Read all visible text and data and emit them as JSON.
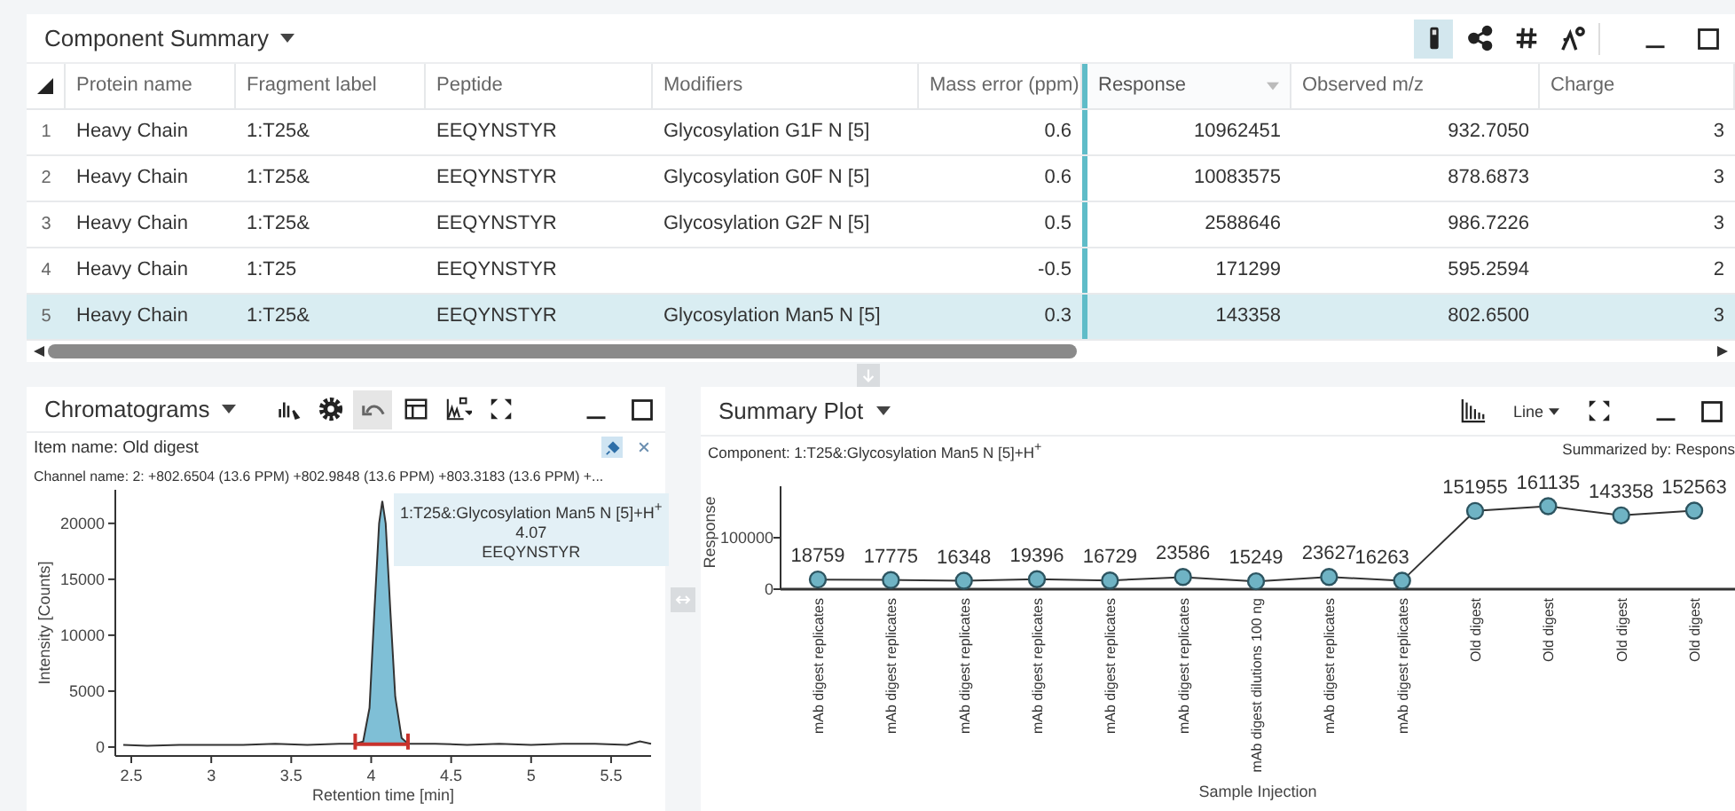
{
  "component_summary": {
    "title": "Component Summary",
    "toolbar": [
      {
        "kind": "test-tube",
        "on": true
      },
      {
        "kind": "nodes",
        "on": false
      },
      {
        "kind": "hash",
        "on": false
      },
      {
        "kind": "peak-settings",
        "on": false
      }
    ],
    "columns": [
      {
        "label": "Protein name",
        "sorted": false
      },
      {
        "label": "Fragment label",
        "sorted": false
      },
      {
        "label": "Peptide",
        "sorted": false
      },
      {
        "label": "Modifiers",
        "sorted": false
      },
      {
        "label": "Mass error (ppm)",
        "sorted": false
      },
      {
        "label": "Response",
        "sorted": true
      },
      {
        "label": "Observed m/z",
        "sorted": false
      },
      {
        "label": "Charge",
        "sorted": false
      }
    ],
    "rows": [
      {
        "number": "1",
        "protein_name": "Heavy Chain",
        "fragment_label": "1:T25&",
        "peptide": "EEQYNSTYR",
        "modifiers": "Glycosylation G1F N [5]",
        "mass_error": "0.6",
        "response": "10962451",
        "observed_mz": "932.7050",
        "charge": "3",
        "selected": false
      },
      {
        "number": "2",
        "protein_name": "Heavy Chain",
        "fragment_label": "1:T25&",
        "peptide": "EEQYNSTYR",
        "modifiers": "Glycosylation G0F N [5]",
        "mass_error": "0.6",
        "response": "10083575",
        "observed_mz": "878.6873",
        "charge": "3",
        "selected": false
      },
      {
        "number": "3",
        "protein_name": "Heavy Chain",
        "fragment_label": "1:T25&",
        "peptide": "EEQYNSTYR",
        "modifiers": "Glycosylation G2F N [5]",
        "mass_error": "0.5",
        "response": "2588646",
        "observed_mz": "986.7226",
        "charge": "3",
        "selected": false
      },
      {
        "number": "4",
        "protein_name": "Heavy Chain",
        "fragment_label": "1:T25",
        "peptide": "EEQYNSTYR",
        "mass_error": "-0.5",
        "response": "171299",
        "observed_mz": "595.2594",
        "charge": "2",
        "selected": false
      },
      {
        "number": "5",
        "protein_name": "Heavy Chain",
        "fragment_label": "1:T25&",
        "peptide": "EEQYNSTYR",
        "modifiers": "Glycosylation Man5 N [5]",
        "mass_error": "0.3",
        "response": "143358",
        "observed_mz": "802.6500",
        "charge": "3",
        "selected": true
      }
    ]
  },
  "chromatograms": {
    "title": "Chromatograms",
    "toolbar": [
      {
        "kind": "peak-pick",
        "on": false
      },
      {
        "kind": "gear",
        "on": false
      },
      {
        "kind": "undo",
        "on": true
      },
      {
        "kind": "table-layout",
        "on": false
      },
      {
        "kind": "chart-options",
        "on": false
      },
      {
        "kind": "expand",
        "on": false
      }
    ],
    "item_name": "Item name: Old digest",
    "channel_name": "Channel name: 2: +802.6504 (13.6 PPM) +802.9848 (13.6 PPM) +803.3183 (13.6 PPM) +...",
    "pinned": true,
    "chart_data": {
      "type": "line",
      "xlabel": "Retention time [min]",
      "ylabel": "Intensity [Counts]",
      "x": [
        2.45,
        2.6,
        2.8,
        3.0,
        3.2,
        3.4,
        3.6,
        3.8,
        3.9,
        3.95,
        3.99,
        4.02,
        4.05,
        4.07,
        4.09,
        4.12,
        4.15,
        4.19,
        4.23,
        4.4,
        4.6,
        4.8,
        5.0,
        5.2,
        5.4,
        5.6,
        5.68,
        5.75
      ],
      "series": [
        {
          "values": [
            200,
            100,
            200,
            200,
            200,
            300,
            200,
            300,
            300,
            500,
            3500,
            12000,
            20000,
            22000,
            20000,
            12000,
            4500,
            800,
            300,
            300,
            200,
            300,
            200,
            300,
            300,
            200,
            500,
            300
          ]
        }
      ],
      "xlim": [
        2.4,
        5.75
      ],
      "ylim": [
        -800,
        23000
      ],
      "xticks": [
        2.5,
        3,
        3.5,
        4,
        4.5,
        5,
        5.5
      ],
      "yticks": [
        0,
        5000,
        10000,
        15000,
        20000
      ],
      "annotations": [
        {
          "text": "1:T25&:Glycosylation Man5 N [5]+H$^{+}$"
        },
        {
          "text": "4.07"
        },
        {
          "text": "EEQYNSTYR"
        }
      ]
    }
  },
  "summary_plot": {
    "title": "Summary Plot",
    "toolbar": [
      {
        "kind": "bar-chart",
        "on": false
      },
      {
        "kind": "dropdown",
        "label": "Line",
        "on": false
      },
      {
        "kind": "expand",
        "on": false
      }
    ],
    "component": "Component: 1:T25&:Glycosylation Man5 N [5]+H$^{+}$",
    "summarized_by": "Summarized by: Respons",
    "chart_data": {
      "type": "line",
      "xlabel": "Sample Injection",
      "ylabel": "Response",
      "categories": [
        "mAb digest replicates",
        "mAb digest replicates",
        "mAb digest replicates",
        "mAb digest replicates",
        "mAb digest replicates",
        "mAb digest replicates",
        "mAb digest dilutions 100 ng",
        "mAb digest replicates",
        "mAb digest replicates",
        "Old digest",
        "Old digest",
        "Old digest",
        "Old digest"
      ],
      "series": [
        {
          "marker": "circle",
          "values": [
            18759,
            17775,
            16348,
            19396,
            16729,
            23586,
            15249,
            23627,
            16263,
            151955,
            161135,
            143358,
            152563
          ]
        }
      ],
      "ylim": [
        0,
        200000
      ],
      "yticks": [
        0,
        100000
      ],
      "data_labels": true
    }
  }
}
